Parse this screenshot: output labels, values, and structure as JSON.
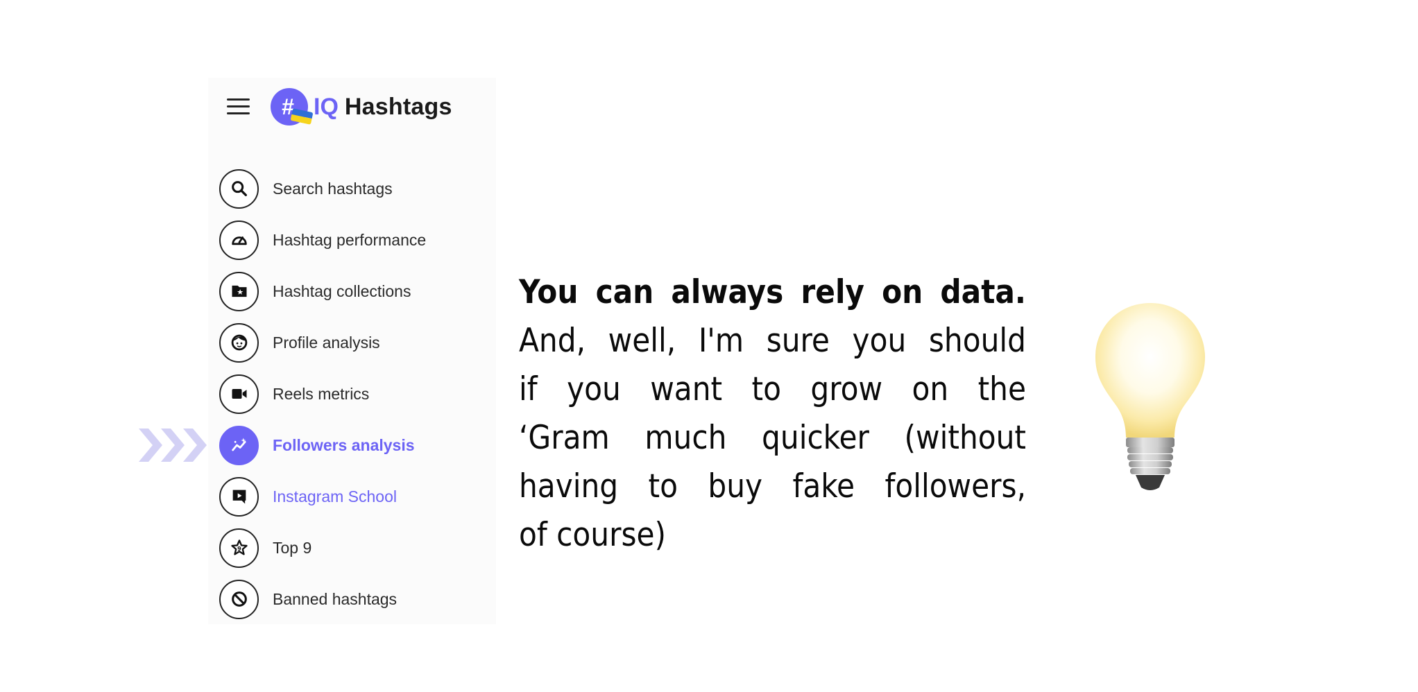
{
  "brand": {
    "logo_hash": "#",
    "logo_iq": "IQ",
    "logo_name": "Hashtags",
    "accent_color": "#6c63f5",
    "menu_icon": "hamburger-icon"
  },
  "sidebar": {
    "items": [
      {
        "label": "Search hashtags",
        "icon": "search-icon",
        "state": "default"
      },
      {
        "label": "Hashtag performance",
        "icon": "speedometer-icon",
        "state": "default"
      },
      {
        "label": "Hashtag collections",
        "icon": "folder-star-icon",
        "state": "default"
      },
      {
        "label": "Profile analysis",
        "icon": "face-icon",
        "state": "default"
      },
      {
        "label": "Reels metrics",
        "icon": "video-camera-icon",
        "state": "default"
      },
      {
        "label": "Followers analysis",
        "icon": "trend-sparkle-icon",
        "state": "active"
      },
      {
        "label": "Instagram School",
        "icon": "play-chat-icon",
        "state": "link"
      },
      {
        "label": "Top 9",
        "icon": "star-nine-icon",
        "state": "default"
      },
      {
        "label": "Banned hashtags",
        "icon": "ban-icon",
        "state": "default"
      }
    ],
    "pointer_icon": "triple-chevron-right-icon"
  },
  "copy": {
    "lines": [
      "You can always rely on data.",
      "And, well, I'm sure you should",
      "if you want to grow on the",
      "‘Gram much quicker (without",
      "having to buy fake followers,",
      "of course)"
    ]
  },
  "decoration": {
    "icon": "lightbulb-icon"
  }
}
